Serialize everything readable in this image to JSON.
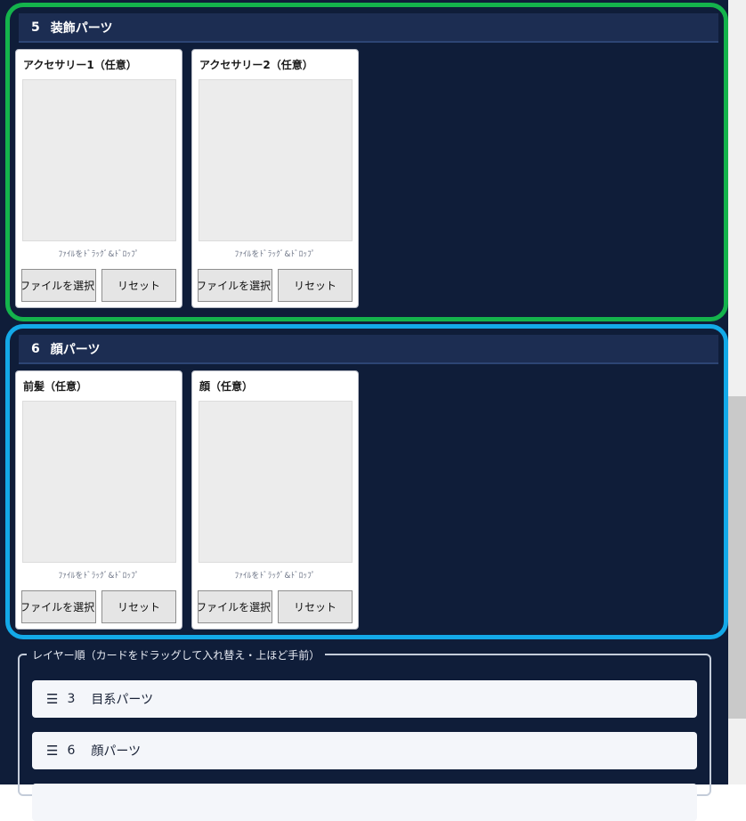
{
  "sections": [
    {
      "number": "5",
      "title": "装飾パーツ",
      "cards": [
        {
          "title": "アクセサリー1（任意）",
          "drop_hint": "ﾌｧｲﾙをﾄﾞﾗｯｸﾞ&ﾄﾞﾛｯﾌﾟ",
          "file_button": "ファイルを選択.",
          "reset_button": "リセット"
        },
        {
          "title": "アクセサリー2（任意）",
          "drop_hint": "ﾌｧｲﾙをﾄﾞﾗｯｸﾞ&ﾄﾞﾛｯﾌﾟ",
          "file_button": "ファイルを選択.",
          "reset_button": "リセット"
        }
      ]
    },
    {
      "number": "6",
      "title": "顔パーツ",
      "cards": [
        {
          "title": "前髪（任意）",
          "drop_hint": "ﾌｧｲﾙをﾄﾞﾗｯｸﾞ&ﾄﾞﾛｯﾌﾟ",
          "file_button": "ファイルを選択.",
          "reset_button": "リセット"
        },
        {
          "title": "顔（任意）",
          "drop_hint": "ﾌｧｲﾙをﾄﾞﾗｯｸﾞ&ﾄﾞﾛｯﾌﾟ",
          "file_button": "ファイルを選択.",
          "reset_button": "リセット"
        }
      ]
    }
  ],
  "layer_order": {
    "legend": "レイヤー順（カードをドラッグして入れ替え・上ほど手前）",
    "handle_icon": "☰",
    "items": [
      {
        "number": "3",
        "label": "目系パーツ"
      },
      {
        "number": "6",
        "label": "顔パーツ"
      },
      {
        "number": "",
        "label": ""
      }
    ]
  },
  "colors": {
    "background": "#0f1d39",
    "section5_border": "#14b34c",
    "section6_border": "#13a9e8"
  }
}
